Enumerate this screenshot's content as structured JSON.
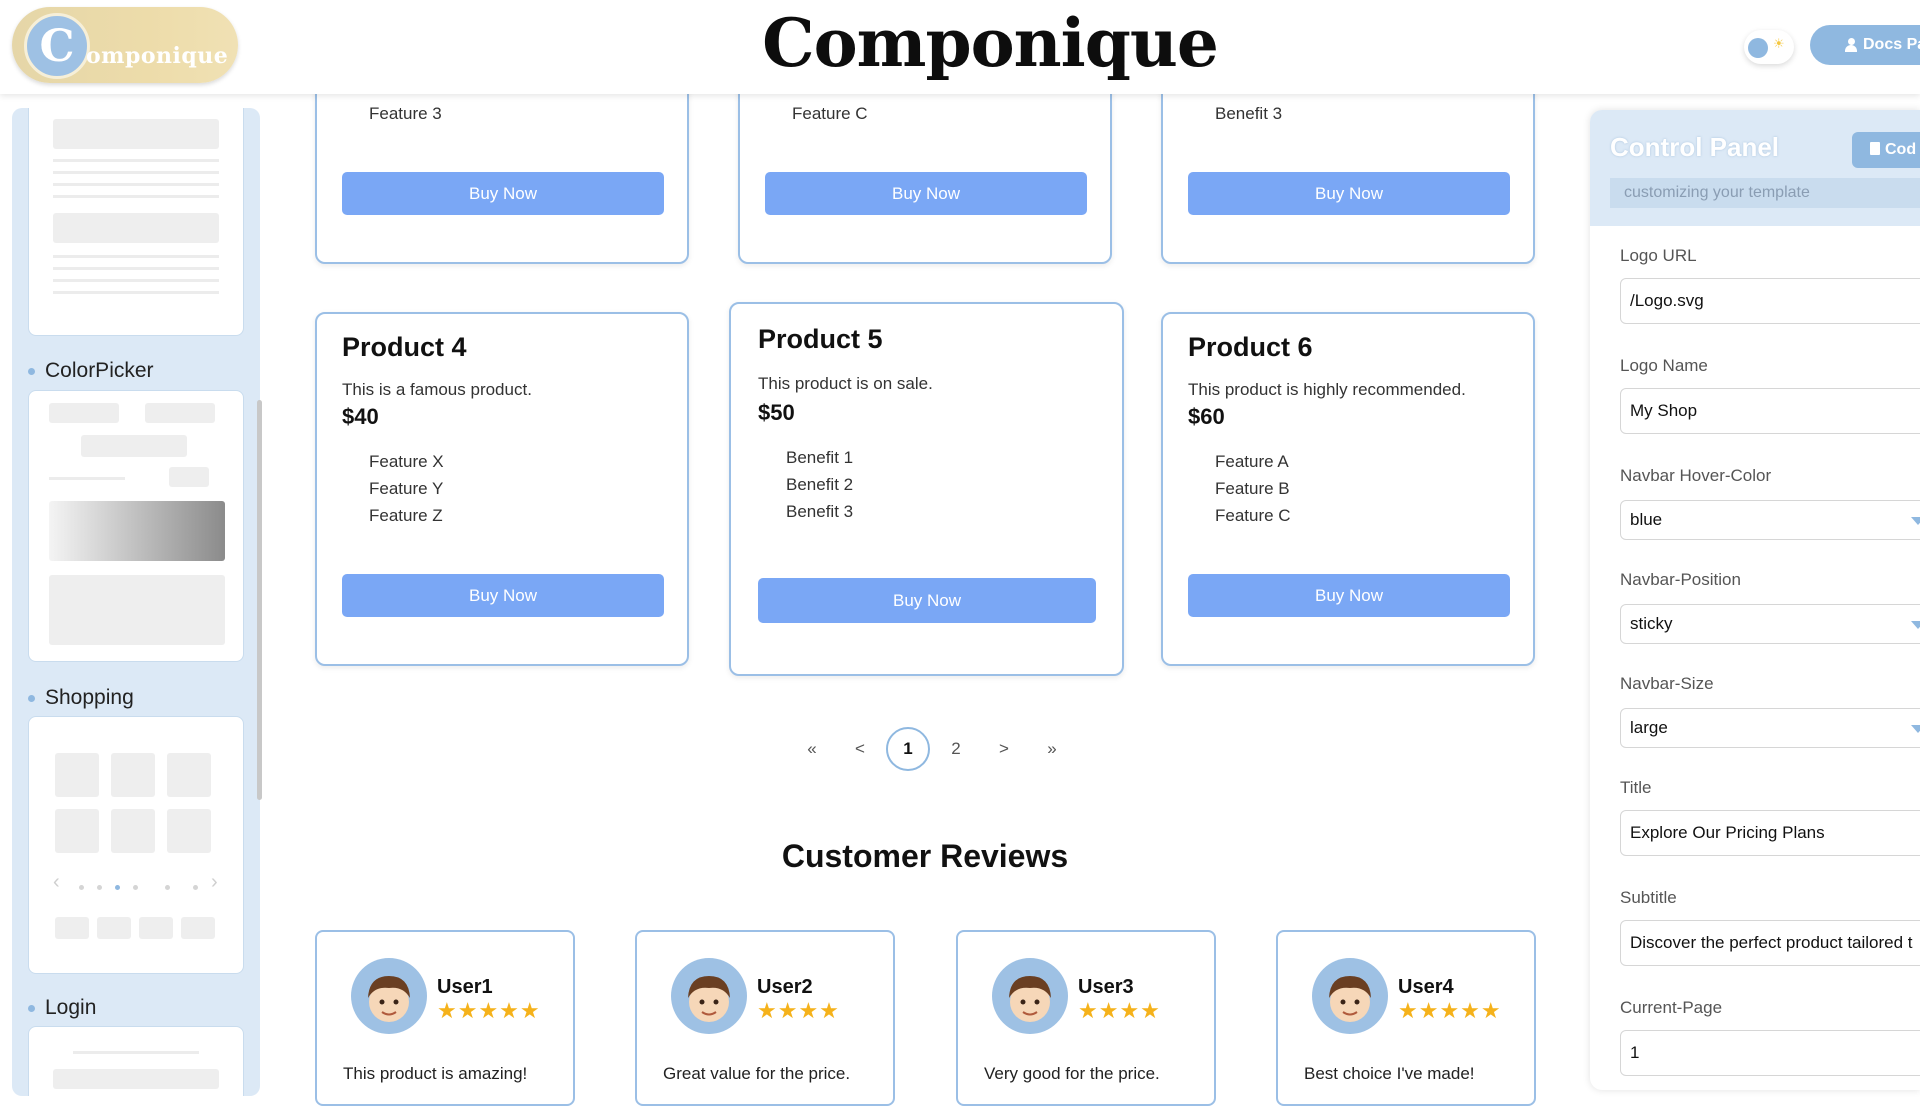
{
  "header": {
    "logo_letter": "C",
    "logo_word": "omponique",
    "brand": "Componique",
    "docs_label": "Docs Pa"
  },
  "sidebar": {
    "labels": [
      "ColorPicker",
      "Shopping",
      "Login"
    ]
  },
  "products_top": [
    {
      "last_item": "Feature 3",
      "button": "Buy Now"
    },
    {
      "last_item": "Feature C",
      "button": "Buy Now"
    },
    {
      "last_item": "Benefit 3",
      "button": "Buy Now"
    }
  ],
  "products": [
    {
      "name": "Product 4",
      "desc": "This is a famous product.",
      "price": "$40",
      "features": [
        "Feature X",
        "Feature Y",
        "Feature Z"
      ],
      "button": "Buy Now"
    },
    {
      "name": "Product 5",
      "desc": "This product is on sale.",
      "price": "$50",
      "features": [
        "Benefit 1",
        "Benefit 2",
        "Benefit 3"
      ],
      "button": "Buy Now"
    },
    {
      "name": "Product 6",
      "desc": "This product is highly recommended.",
      "price": "$60",
      "features": [
        "Feature A",
        "Feature B",
        "Feature C"
      ],
      "button": "Buy Now"
    }
  ],
  "pagination": {
    "first": "«",
    "prev": "<",
    "pages": [
      "1",
      "2"
    ],
    "current": "1",
    "next": ">",
    "last": "»"
  },
  "reviews": {
    "heading": "Customer Reviews",
    "items": [
      {
        "user": "User1",
        "rating": 5,
        "stars": "★★★★★",
        "text": "This product is amazing!"
      },
      {
        "user": "User2",
        "rating": 4,
        "stars": "★★★★",
        "text": "Great value for the price."
      },
      {
        "user": "User3",
        "rating": 4,
        "stars": "★★★★",
        "text": "Very good for the price."
      },
      {
        "user": "User4",
        "rating": 5,
        "stars": "★★★★★",
        "text": "Best choice I've made!"
      }
    ]
  },
  "control_panel": {
    "title": "Control Panel",
    "code_button": "Cod",
    "subtitle": "customizing your template",
    "fields": {
      "logo_url": {
        "label": "Logo URL",
        "value": "/Logo.svg"
      },
      "logo_name": {
        "label": "Logo Name",
        "value": "My Shop"
      },
      "navbar_hover": {
        "label": "Navbar Hover-Color",
        "value": "blue"
      },
      "navbar_position": {
        "label": "Navbar-Position",
        "value": "sticky"
      },
      "navbar_size": {
        "label": "Navbar-Size",
        "value": "large"
      },
      "title": {
        "label": "Title",
        "value": "Explore Our Pricing Plans"
      },
      "subtitle": {
        "label": "Subtitle",
        "value": "Discover the perfect product tailored t"
      },
      "current_page": {
        "label": "Current-Page",
        "value": "1"
      }
    }
  },
  "colors": {
    "accent": "#8fb8e0",
    "button": "#7aa7f5",
    "card_border": "#9bbfe6",
    "sidebar_bg": "#dce9f6",
    "star": "#f5b21b"
  },
  "icons": [
    "sun-icon",
    "user-icon",
    "document-icon",
    "chevron-down-icon",
    "star-icon",
    "avatar-icon"
  ]
}
